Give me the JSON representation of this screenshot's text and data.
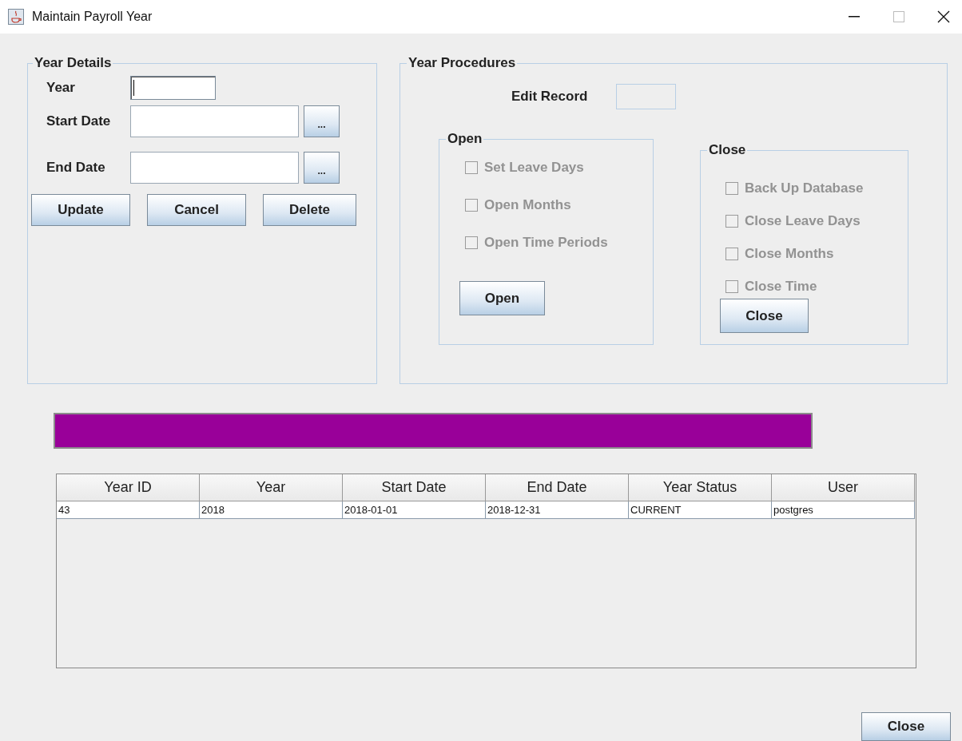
{
  "window": {
    "title": "Maintain Payroll Year"
  },
  "year_details": {
    "title": "Year Details",
    "fields": [
      {
        "kind": "short",
        "label": "Year",
        "focused": true
      },
      {
        "kind": "date",
        "label": "Start Date",
        "focused": false,
        "picker": "..."
      },
      {
        "kind": "date",
        "label": "End Date",
        "focused": false,
        "picker": "..."
      }
    ],
    "buttons": [
      "Update",
      "Cancel",
      "Delete"
    ]
  },
  "year_procedures": {
    "title": "Year Procedures",
    "edit_record": {
      "label": "Edit Record",
      "disabled": true
    },
    "open": {
      "title": "Open",
      "options": [
        {
          "label": "Set Leave Days",
          "checked": false,
          "disabled": true
        },
        {
          "label": "Open Months",
          "checked": false,
          "disabled": true
        },
        {
          "label": "Open Time Periods",
          "checked": false,
          "disabled": true
        }
      ],
      "button": "Open"
    },
    "close": {
      "title": "Close",
      "options": [
        {
          "label": "Back Up Database",
          "checked": false,
          "disabled": true
        },
        {
          "label": "Close Leave Days",
          "checked": false,
          "disabled": true
        },
        {
          "label": "Close Months",
          "checked": false,
          "disabled": true
        },
        {
          "label": "Close Time",
          "checked": false,
          "disabled": true
        }
      ],
      "button": "Close"
    }
  },
  "progress": {
    "level": 1
  },
  "table": {
    "columns": [
      "Year ID",
      "Year",
      "Start Date",
      "End Date",
      "Year Status",
      "User"
    ],
    "rows": [
      [
        "43",
        "2018",
        "2018-01-01",
        "2018-12-31",
        "CURRENT",
        "postgres"
      ]
    ]
  },
  "footer_button": "Close"
}
